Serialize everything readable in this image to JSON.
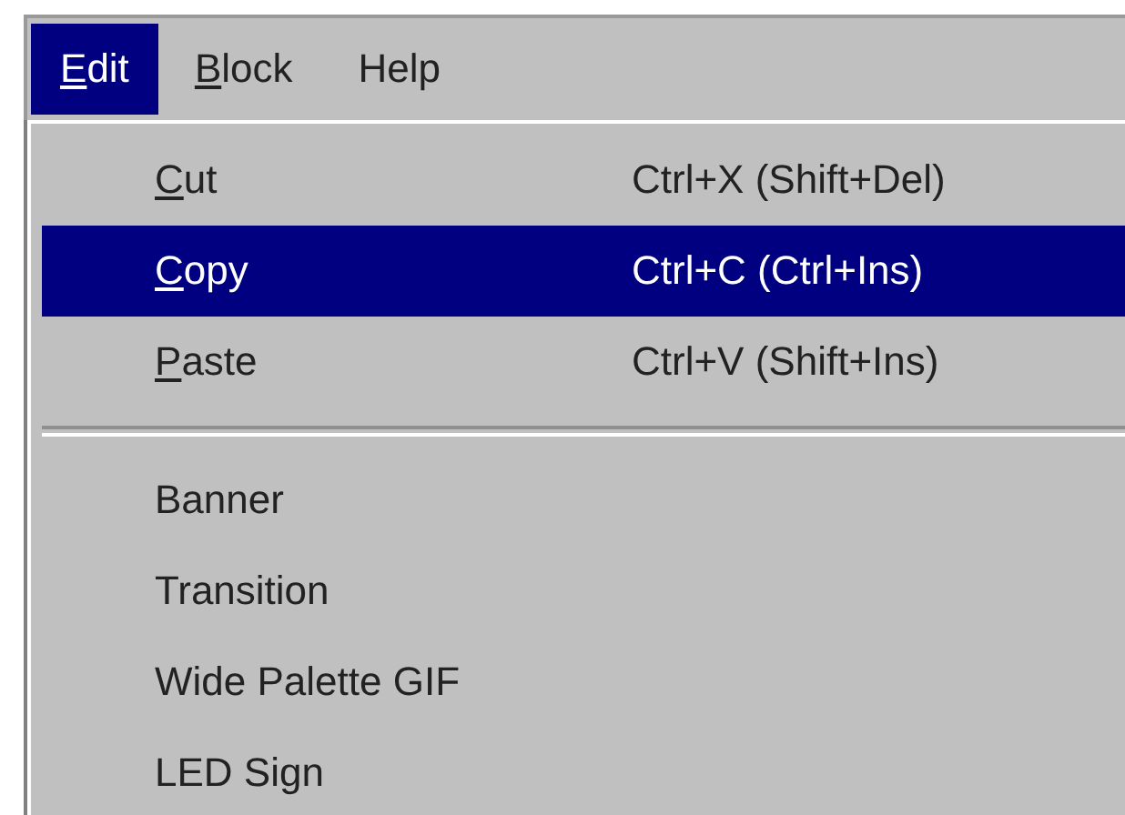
{
  "menubar": [
    {
      "key": "E",
      "rest": "dit",
      "selected": true
    },
    {
      "key": "B",
      "rest": "lock",
      "selected": false
    },
    {
      "rest": "Help",
      "selected": false
    }
  ],
  "menu": {
    "items": [
      {
        "kind": "command",
        "key": "C",
        "rest": "ut",
        "shortcut": "Ctrl+X (Shift+Del)",
        "selected": false
      },
      {
        "kind": "command",
        "key": "C",
        "rest": "opy",
        "shortcut": "Ctrl+C (Ctrl+Ins)",
        "selected": true
      },
      {
        "kind": "command",
        "key": "P",
        "rest": "aste",
        "shortcut": "Ctrl+V (Shift+Ins)",
        "selected": false
      },
      {
        "kind": "separator"
      },
      {
        "kind": "command",
        "rest": "Banner",
        "selected": false
      },
      {
        "kind": "command",
        "rest": "Transition",
        "selected": false
      },
      {
        "kind": "command",
        "rest": "Wide Palette GIF",
        "selected": false
      },
      {
        "kind": "command",
        "rest": "LED Sign",
        "selected": false
      }
    ]
  }
}
